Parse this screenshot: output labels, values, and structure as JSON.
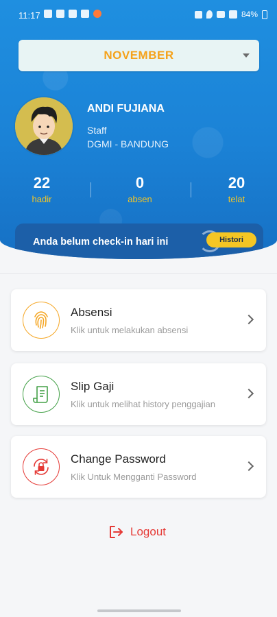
{
  "status_bar": {
    "time": "11:17",
    "battery": "84%"
  },
  "header": {
    "month": "NOVEMBER"
  },
  "profile": {
    "name": "ANDI FUJIANA",
    "role": "Staff",
    "office": "DGMI - BANDUNG"
  },
  "stats": [
    {
      "value": "22",
      "label": "hadir"
    },
    {
      "value": "0",
      "label": "absen"
    },
    {
      "value": "20",
      "label": "telat"
    }
  ],
  "checkin": {
    "message": "Anda belum check-in hari ini",
    "history_button": "Histori"
  },
  "menu": [
    {
      "title": "Absensi",
      "subtitle": "Klik untuk melakukan absensi",
      "icon": "fingerprint-icon",
      "color": "#f5a623"
    },
    {
      "title": "Slip Gaji",
      "subtitle": "Klik untuk melihat history penggajian",
      "icon": "receipt-icon",
      "color": "#43a047"
    },
    {
      "title": "Change Password",
      "subtitle": "Klik Untuk Mengganti Password",
      "icon": "lock-refresh-icon",
      "color": "#e53935"
    }
  ],
  "logout": {
    "label": "Logout",
    "color": "#e53935"
  },
  "colors": {
    "accent_yellow": "#f5c624",
    "month_orange": "#f5a21b",
    "header_blue": "#1f8fe0",
    "banner_blue": "#1c5fa8"
  }
}
